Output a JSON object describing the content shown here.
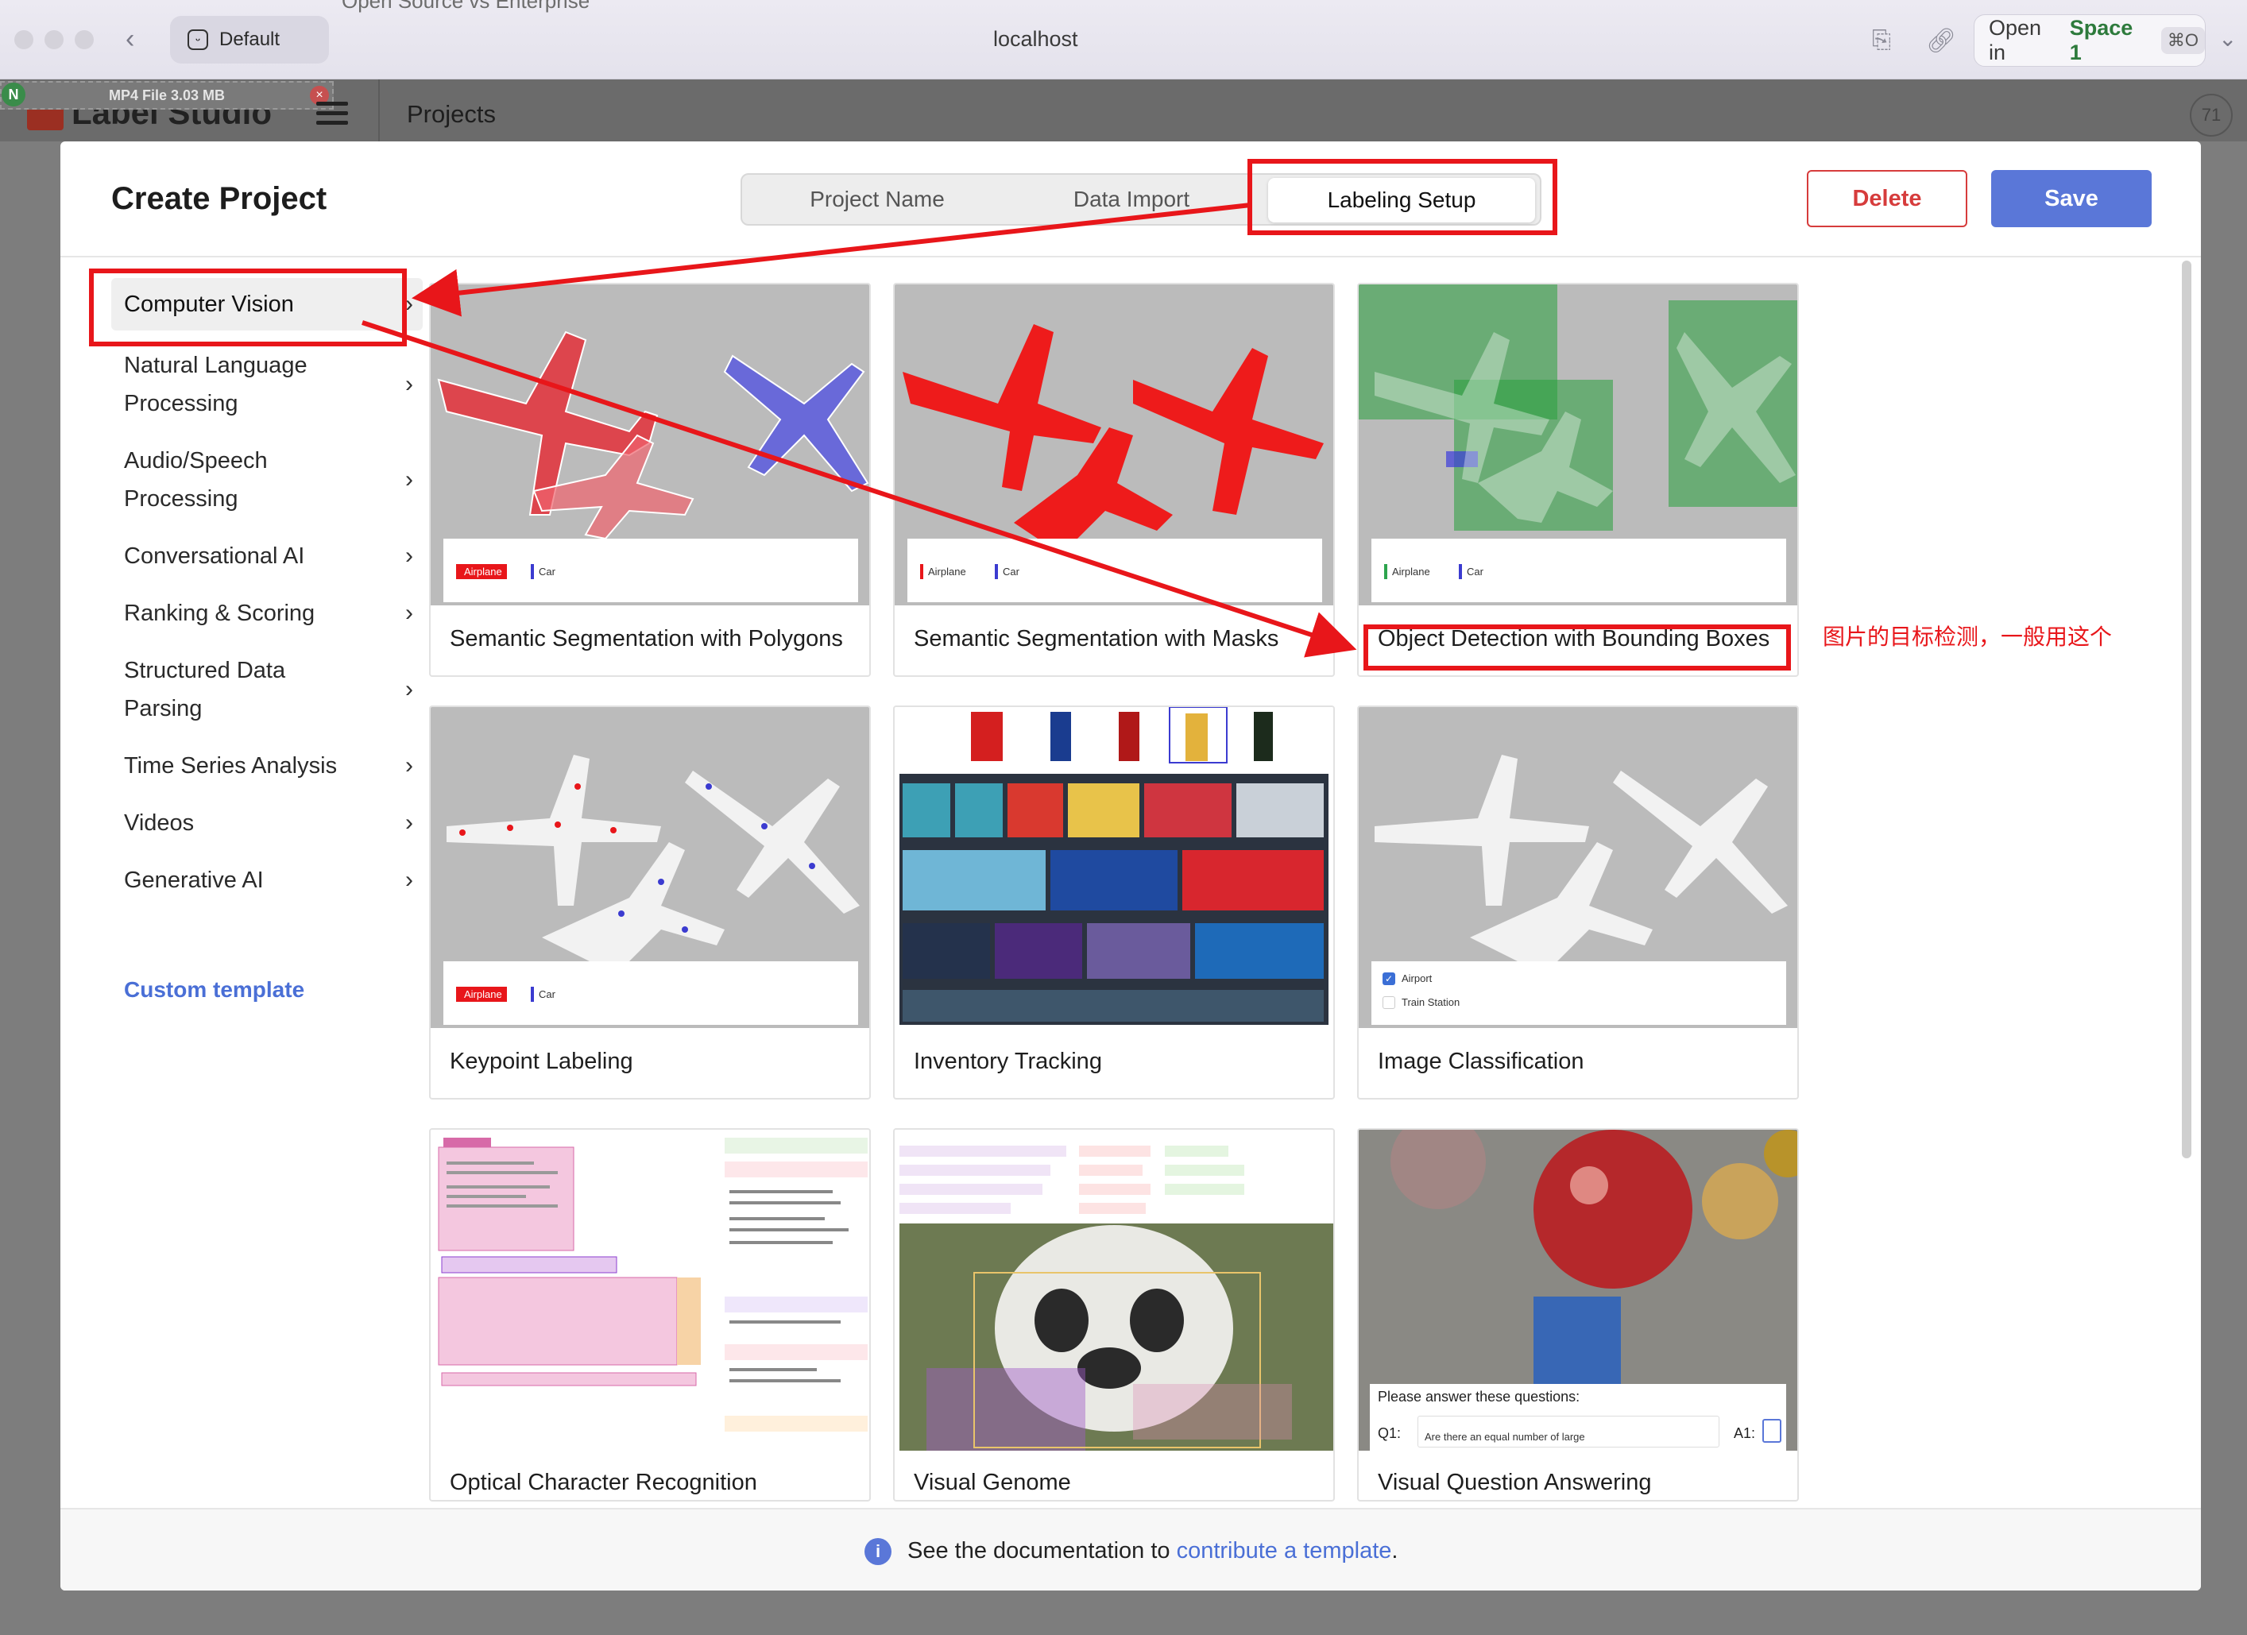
{
  "browser": {
    "profile": "Default",
    "url": "localhost",
    "tab_ghost": "Open Source vs Enterprise",
    "open_in": "Open in",
    "space": "Space 1",
    "shortcut": "⌘O"
  },
  "download_badge": {
    "label": "MP4 File 3.03 MB"
  },
  "app": {
    "logo": "Label Studio",
    "breadcrumb": "Projects",
    "avatar": "71"
  },
  "modal": {
    "title": "Create Project",
    "steps": [
      "Project Name",
      "Data Import",
      "Labeling Setup"
    ],
    "active_step": "Labeling Setup",
    "delete_label": "Delete",
    "save_label": "Save"
  },
  "sidebar": {
    "items": [
      {
        "line1": "Computer Vision",
        "line2": ""
      },
      {
        "line1": "Natural Language",
        "line2": "Processing"
      },
      {
        "line1": "Audio/Speech",
        "line2": "Processing"
      },
      {
        "line1": "Conversational AI",
        "line2": ""
      },
      {
        "line1": "Ranking & Scoring",
        "line2": ""
      },
      {
        "line1": "Structured Data",
        "line2": "Parsing"
      },
      {
        "line1": "Time Series Analysis",
        "line2": ""
      },
      {
        "line1": "Videos",
        "line2": ""
      },
      {
        "line1": "Generative AI",
        "line2": ""
      }
    ],
    "custom_template": "Custom template"
  },
  "templates": [
    {
      "title": "Semantic Segmentation with Polygons",
      "tags": [
        "Airplane",
        "Car"
      ]
    },
    {
      "title": "Semantic Segmentation with Masks",
      "tags": [
        "Airplane",
        "Car"
      ]
    },
    {
      "title": "Object Detection with Bounding Boxes",
      "tags": [
        "Airplane",
        "Car"
      ]
    },
    {
      "title": "Keypoint Labeling",
      "tags": [
        "Airplane",
        "Car"
      ]
    },
    {
      "title": "Inventory Tracking",
      "tags": []
    },
    {
      "title": "Image Classification",
      "tags": [
        "Airport",
        "Train Station"
      ]
    },
    {
      "title": "Optical Character Recognition",
      "tags": []
    },
    {
      "title": "Visual Genome",
      "tags": []
    },
    {
      "title": "Visual Question Answering",
      "tags": []
    }
  ],
  "vqa_preview": {
    "prompt": "Please answer these questions:",
    "q1": "Q1:",
    "q1_text": "Are there an equal number of large",
    "a1": "A1:"
  },
  "annotation_note": "图片的目标检测，一般用这个",
  "footer": {
    "prefix": "See the documentation to",
    "link": "contribute a template",
    "suffix": "."
  },
  "colors": {
    "accent": "#5a77d8",
    "danger": "#d63c3c",
    "annotation_red": "#e8161a"
  }
}
